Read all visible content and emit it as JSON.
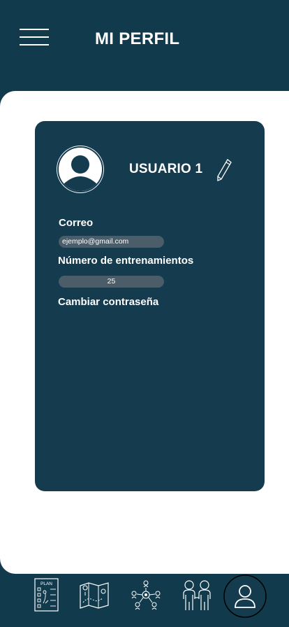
{
  "header": {
    "title": "MI PERFIL"
  },
  "profile": {
    "username": "USUARIO 1",
    "email_label": "Correo",
    "email_value": "ejemplo@gmail.com",
    "trainings_label": "Número de entrenamientos",
    "trainings_value": "25",
    "change_password_label": "Cambiar contraseña"
  },
  "bottom_nav": {
    "plan_icon_text": "PLAN",
    "items": [
      {
        "icon": "plan-checklist-icon"
      },
      {
        "icon": "map-icon"
      },
      {
        "icon": "team-network-icon"
      },
      {
        "icon": "people-icon"
      },
      {
        "icon": "user-profile-icon",
        "active": true
      }
    ]
  },
  "colors": {
    "primary": "#123a4d",
    "card": "#153b4f",
    "pill": "#4a5d69",
    "background": "#ffffff"
  }
}
